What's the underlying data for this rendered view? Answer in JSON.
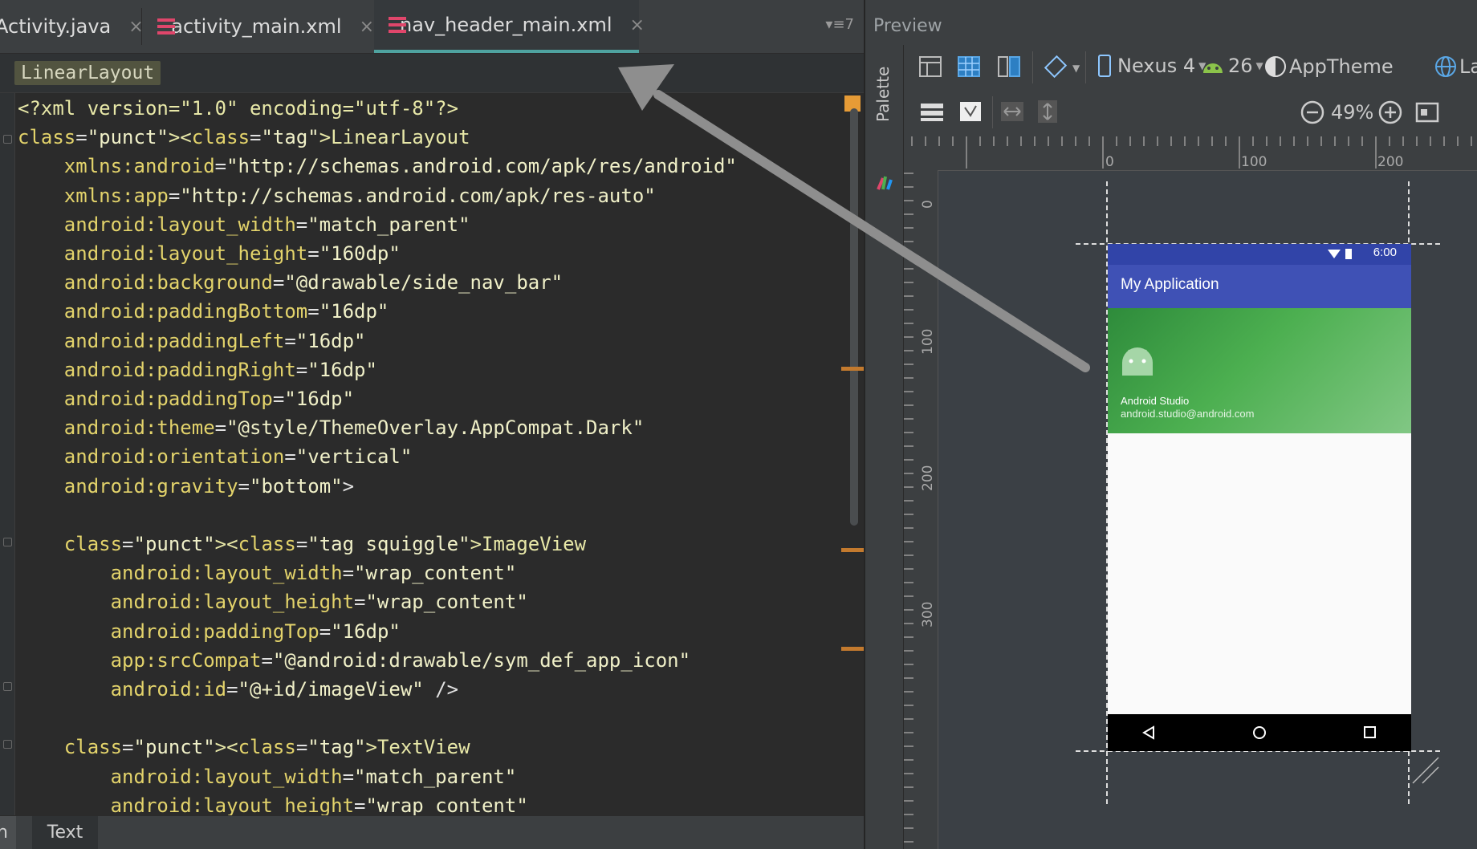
{
  "editor": {
    "tabs": [
      {
        "label": "Activity.java",
        "active": false
      },
      {
        "label": "activity_main.xml",
        "active": false
      },
      {
        "label": "nav_header_main.xml",
        "active": true
      }
    ],
    "tab_close_glyph": "×",
    "tab_overflow": "7",
    "breadcrumb": "LinearLayout",
    "bottom_tabs": {
      "design": "n",
      "text": "Text"
    },
    "code_lines": [
      "<?xml version=\"1.0\" encoding=\"utf-8\"?>",
      "<LinearLayout",
      "    xmlns:android=\"http://schemas.android.com/apk/res/android\"",
      "    xmlns:app=\"http://schemas.android.com/apk/res-auto\"",
      "    android:layout_width=\"match_parent\"",
      "    android:layout_height=\"160dp\"",
      "    android:background=\"@drawable/side_nav_bar\"",
      "    android:paddingBottom=\"16dp\"",
      "    android:paddingLeft=\"16dp\"",
      "    android:paddingRight=\"16dp\"",
      "    android:paddingTop=\"16dp\"",
      "    android:theme=\"@style/ThemeOverlay.AppCompat.Dark\"",
      "    android:orientation=\"vertical\"",
      "    android:gravity=\"bottom\">",
      "",
      "    <ImageView",
      "        android:layout_width=\"wrap_content\"",
      "        android:layout_height=\"wrap_content\"",
      "        android:paddingTop=\"16dp\"",
      "        app:srcCompat=\"@android:drawable/sym_def_app_icon\"",
      "        android:id=\"@+id/imageView\" />",
      "",
      "    <TextView",
      "        android:layout_width=\"match_parent\"",
      "        android:layout_height=\"wrap_content\""
    ]
  },
  "preview": {
    "title": "Preview",
    "palette_label": "Palette",
    "device": "Nexus 4",
    "api_level": "26",
    "theme": "AppTheme",
    "locale": "La",
    "zoom": "49%",
    "ruler_top": [
      "0",
      "100",
      "200"
    ],
    "ruler_left": [
      "0",
      "100",
      "200",
      "300"
    ],
    "phone": {
      "status_time": "6:00",
      "app_title": "My Application",
      "nav_name": "Android Studio",
      "nav_email": "android.studio@android.com"
    }
  },
  "colors": {
    "tag": "#ec3f5f",
    "attribute": "#e3d36b",
    "app_bar": "#3f51b5",
    "status_bar": "#3144a8",
    "nav_header_start": "#2e8b3b",
    "nav_header_end": "#81c784",
    "accent_tab": "#4fa3a0",
    "arrow": "#8e8e8e"
  }
}
